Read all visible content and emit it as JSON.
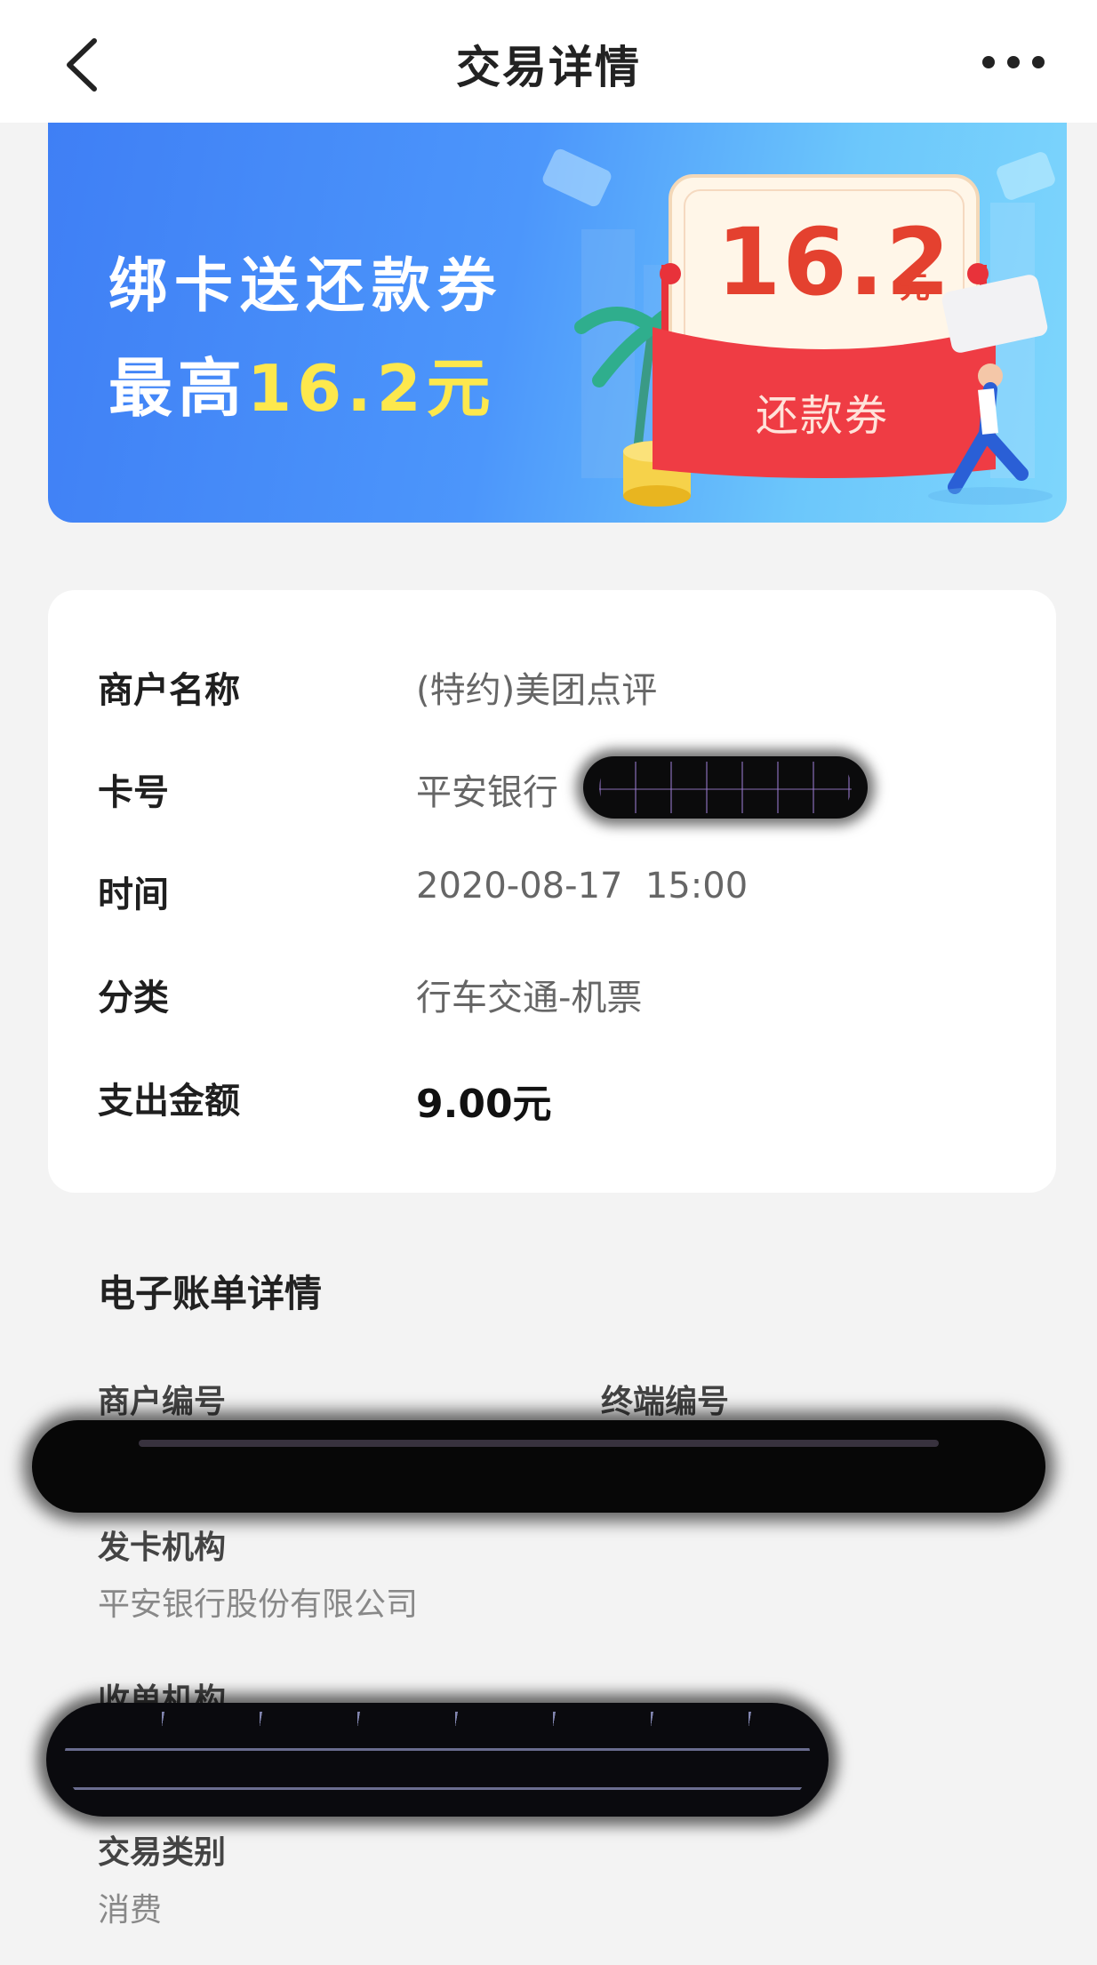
{
  "header": {
    "title": "交易详情",
    "back_icon": "chevron-left-icon",
    "more_icon": "more-horizontal-icon"
  },
  "banner": {
    "line1": "绑卡送还款券",
    "line2_prefix": "最高",
    "line2_highlight": "16.2元",
    "coupon_amount": "16.2",
    "coupon_unit": "元",
    "coupon_label": "还款券",
    "colors": {
      "accent_yellow": "#fde84d",
      "coupon_red": "#e4412f",
      "banner_blue": "#3f7ff5"
    }
  },
  "transaction": {
    "rows": [
      {
        "label": "商户名称",
        "value": "(特约)美团点评"
      },
      {
        "label": "卡号",
        "value": "平安银行"
      },
      {
        "label": "时间",
        "value": "2020-08-17  15:00"
      },
      {
        "label": "分类",
        "value": "行车交通-机票"
      },
      {
        "label": "支出金额",
        "value": "9.00元"
      }
    ]
  },
  "ebill": {
    "title": "电子账单详情",
    "merchant_no_label": "商户编号",
    "terminal_no_label": "终端编号",
    "issuer_label": "发卡机构",
    "issuer_value": "平安银行股份有限公司",
    "acquirer_label": "收单机构",
    "type_label": "交易类别",
    "type_value": "消费"
  }
}
